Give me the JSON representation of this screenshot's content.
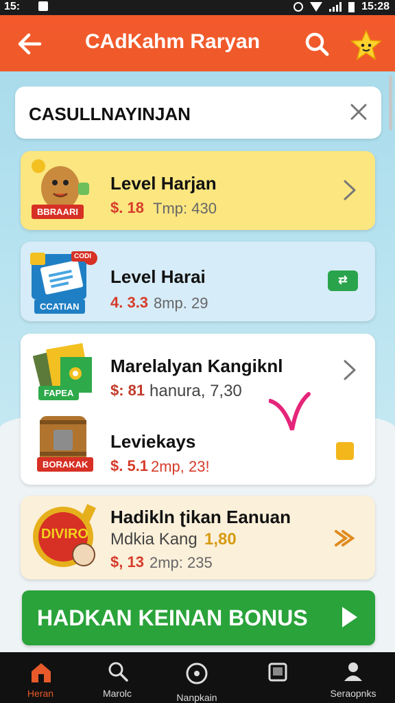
{
  "status_bar": {
    "time_left": "15:",
    "time_right": "15:28"
  },
  "header": {
    "title": "CAdKahm Raryan",
    "back_icon": "arrow-left-icon",
    "search_icon": "search-icon",
    "mascot_icon": "star-mascot-icon"
  },
  "search": {
    "text": "CASULLNAYINJAN",
    "close_icon": "close-icon"
  },
  "items": [
    {
      "badge": "BBRAARI",
      "title": "Level Harjan",
      "price": "$. 18",
      "sub": "Tmp: 430",
      "action_icon": "chevron-right-icon"
    },
    {
      "badge": "CCATIAN",
      "badge_top": "CODI",
      "title": "Level Harai",
      "price": "4. 3.3",
      "sub": "8mp. 29",
      "action_text": "⇄"
    },
    {
      "badge": "FAPEA",
      "title": "Marelalyan Kangiknl",
      "price": "$: 81",
      "sub": "hanura, 7,30",
      "action_icon": "chevron-right-icon"
    },
    {
      "badge": "BORAKAK",
      "title": "Leviekays",
      "price": "$. 5.1",
      "sub": "2mp, 23!",
      "action_icon": "yellow-tag-icon"
    },
    {
      "badge": "DIVIRO",
      "title": "Hadikln ʈikan Eanuan",
      "line2a": "Mdkia Kang",
      "line2b": "1,80",
      "price": "$, 13",
      "sub": "2mp: 235",
      "action_icon": "arrow-icon"
    }
  ],
  "cta": {
    "label": "HADKAN KEINAN BONUS"
  },
  "nav": [
    {
      "label": "Heran",
      "icon": "home-icon"
    },
    {
      "label": "Marolc",
      "icon": "search-icon"
    },
    {
      "label": "Nanpkain",
      "icon": "disc-icon"
    },
    {
      "label": "",
      "icon": "square-icon"
    },
    {
      "label": "Seraopnks",
      "icon": "profile-icon"
    }
  ],
  "colors": {
    "accent": "#ef5a2a",
    "green": "#2aa33a",
    "price": "#d63b2a"
  }
}
